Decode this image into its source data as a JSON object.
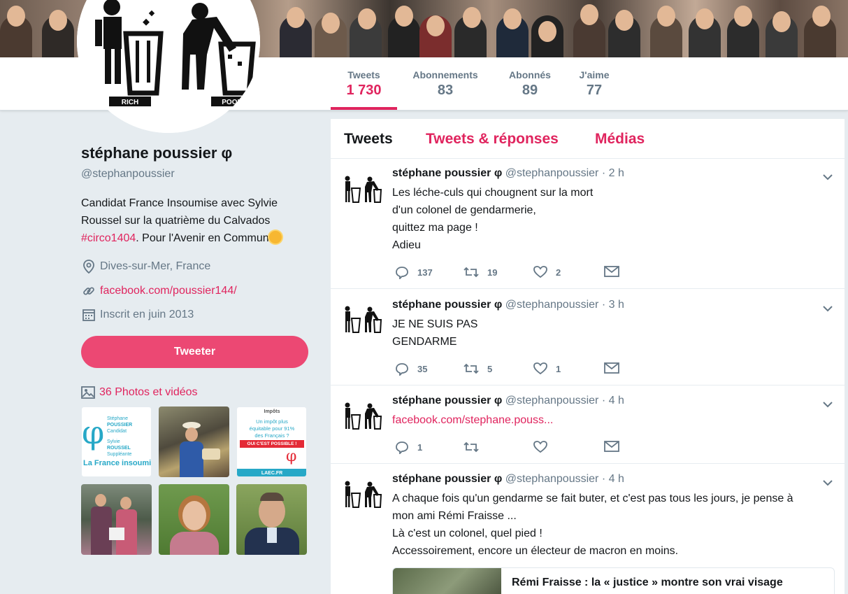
{
  "profile": {
    "name": "stéphane poussier φ",
    "handle": "@stephanpoussier",
    "bio_part1": "Candidat France Insoumise avec Sylvie Roussel sur la quatrième du Calvados ",
    "bio_hashtag": "#circo1404",
    "bio_part2": ". Pour l'Avenir en Commun",
    "location": "Dives-sur-Mer, France",
    "website": "facebook.com/poussier144/",
    "joined": "Inscrit en juin 2013",
    "tweet_button": "Tweeter",
    "photos_label": "36 Photos et vidéos",
    "avatar_labels": [
      "RICH",
      "POOR"
    ]
  },
  "stats": [
    {
      "label": "Tweets",
      "value": "1 730"
    },
    {
      "label": "Abonnements",
      "value": "83"
    },
    {
      "label": "Abonnés",
      "value": "89"
    },
    {
      "label": "J'aime",
      "value": "77"
    }
  ],
  "tabs": [
    "Tweets",
    "Tweets & réponses",
    "Médias"
  ],
  "thumbnails": {
    "t1": {
      "line1": "Stéphane",
      "line2": "POUSSIER",
      "line3": "Candidat",
      "line4": "Sylvie",
      "line5": "ROUSSEL",
      "line6": "Suppléante",
      "brand": "La France insoumise"
    },
    "t3": {
      "line1": "Impôts",
      "line2": "Un impôt plus",
      "line3": "équitable pour 91%",
      "line4": "des Français ?",
      "line5": "OUI C'EST POSSIBLE !",
      "brand": "LAEC.FR"
    }
  },
  "tweets": [
    {
      "name": "stéphane poussier φ",
      "meta": "@stephanpoussier · 2 h",
      "lines": [
        "Les léche-culs qui chougnent sur la mort",
        "d'un colonel de gendarmerie,",
        "quittez ma page !",
        "Adieu"
      ],
      "replies": "137",
      "retweets": "19",
      "likes": "2"
    },
    {
      "name": "stéphane poussier φ",
      "meta": "@stephanpoussier · 3 h",
      "lines": [
        "JE NE SUIS PAS",
        "GENDARME"
      ],
      "replies": "35",
      "retweets": "5",
      "likes": "1"
    },
    {
      "name": "stéphane poussier φ",
      "meta": "@stephanpoussier · 4 h",
      "link": "facebook.com/stephane.pouss...",
      "replies": "1",
      "retweets": "",
      "likes": ""
    },
    {
      "name": "stéphane poussier φ",
      "meta": "@stephanpoussier · 4 h",
      "lines": [
        "A chaque fois qu'un gendarme se fait buter, et c'est pas tous les jours, je pense à",
        "mon ami Rémi Fraisse ...",
        "Là c'est un colonel, quel pied !",
        "Accessoirement, encore un électeur de macron en moins."
      ],
      "card_title": "Rémi Fraisse : la « justice » montre son vrai visage"
    }
  ]
}
